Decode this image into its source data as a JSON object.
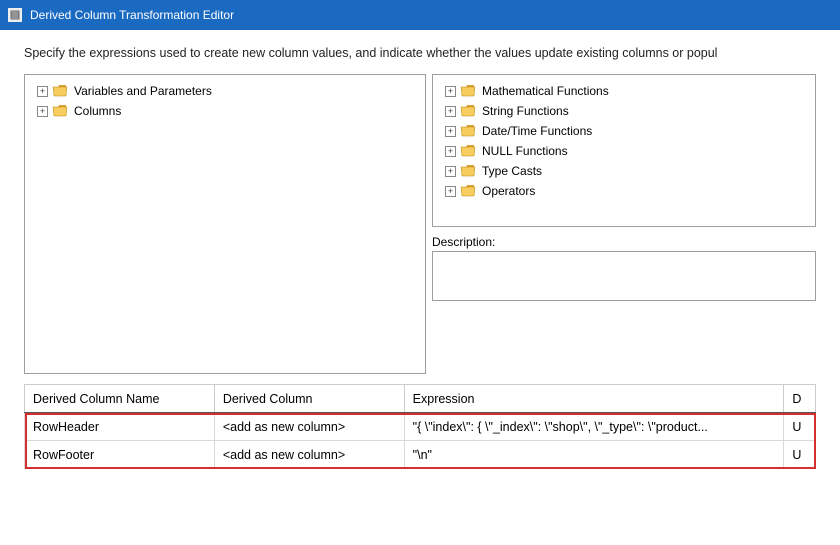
{
  "titlebar": {
    "title": "Derived Column Transformation Editor"
  },
  "subtitle": "Specify the expressions used to create new column values, and indicate whether the values update existing columns or popul",
  "leftTree": {
    "items": [
      {
        "label": "Variables and Parameters"
      },
      {
        "label": "Columns"
      }
    ]
  },
  "rightTree": {
    "items": [
      {
        "label": "Mathematical Functions"
      },
      {
        "label": "String Functions"
      },
      {
        "label": "Date/Time Functions"
      },
      {
        "label": "NULL Functions"
      },
      {
        "label": "Type Casts"
      },
      {
        "label": "Operators"
      }
    ]
  },
  "description": {
    "label": "Description:"
  },
  "grid": {
    "headers": {
      "name": "Derived Column Name",
      "derived": "Derived Column",
      "expression": "Expression",
      "d": "D"
    },
    "rows": [
      {
        "name": "RowHeader",
        "derived": "<add as new column>",
        "expression": "\"{ \\\"index\\\": { \\\"_index\\\": \\\"shop\\\", \\\"_type\\\": \\\"product...",
        "d": "U"
      },
      {
        "name": "RowFooter",
        "derived": "<add as new column>",
        "expression": "\"\\n\"",
        "d": "U"
      }
    ]
  }
}
